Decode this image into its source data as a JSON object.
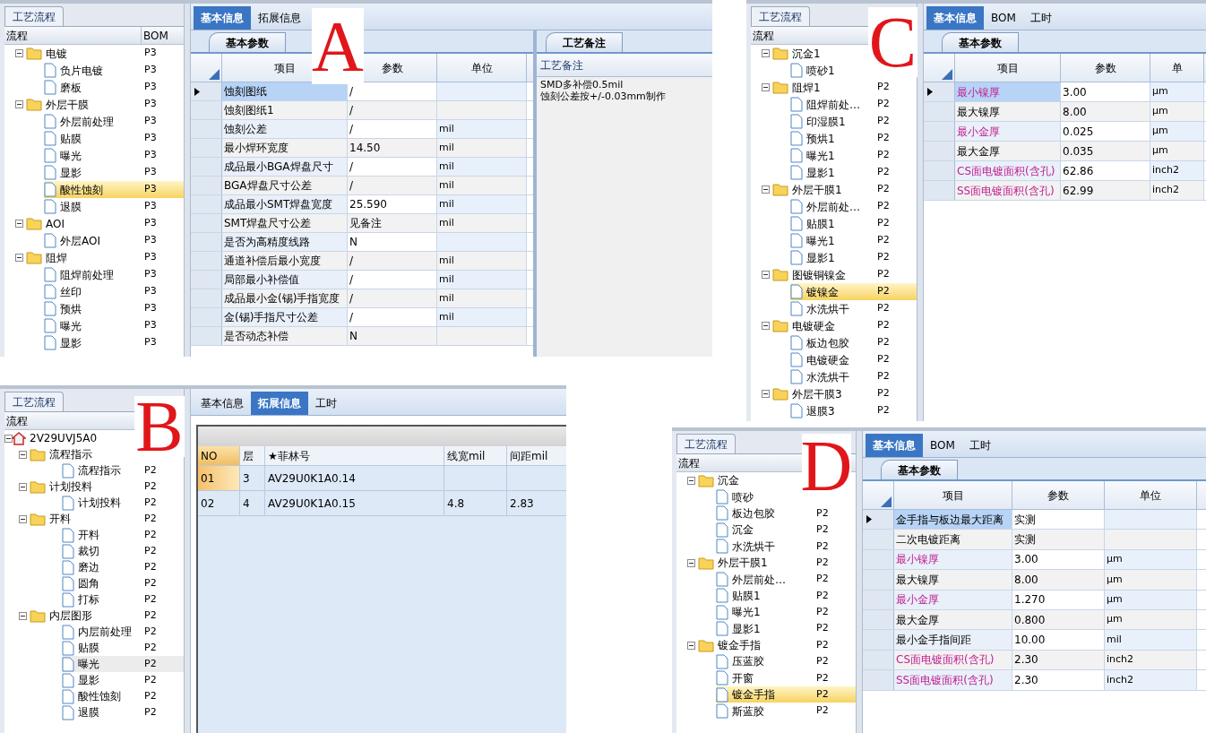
{
  "panels": [
    {
      "letter": "A",
      "tree_focused": true,
      "tree": {
        "tab": "工艺流程",
        "columns": [
          "流程",
          "BOM"
        ],
        "nodes": [
          {
            "kind": "folder",
            "label": "电镀",
            "code": "P3",
            "expanded": true,
            "selected": false,
            "children": [
              {
                "kind": "file",
                "label": "负片电镀",
                "code": "P3",
                "selected": false
              },
              {
                "kind": "file",
                "label": "磨板",
                "code": "P3",
                "selected": false
              }
            ]
          },
          {
            "kind": "folder",
            "label": "外层干膜",
            "code": "P3",
            "expanded": true,
            "selected": false,
            "children": [
              {
                "kind": "file",
                "label": "外层前处理",
                "code": "P3",
                "selected": false
              },
              {
                "kind": "file",
                "label": "贴膜",
                "code": "P3",
                "selected": false
              },
              {
                "kind": "file",
                "label": "曝光",
                "code": "P3",
                "selected": false
              },
              {
                "kind": "file",
                "label": "显影",
                "code": "P3",
                "selected": false
              },
              {
                "kind": "file",
                "label": "酸性蚀刻",
                "code": "P3",
                "selected": true
              },
              {
                "kind": "file",
                "label": "退膜",
                "code": "P3",
                "selected": false
              }
            ]
          },
          {
            "kind": "folder",
            "label": "AOI",
            "code": "P3",
            "expanded": true,
            "selected": false,
            "children": [
              {
                "kind": "file",
                "label": "外层AOI",
                "code": "P3",
                "selected": false
              }
            ]
          },
          {
            "kind": "folder",
            "label": "阻焊",
            "code": "P3",
            "expanded": true,
            "selected": false,
            "children": [
              {
                "kind": "file",
                "label": "阻焊前处理",
                "code": "P3",
                "selected": false
              },
              {
                "kind": "file",
                "label": "丝印",
                "code": "P3",
                "selected": false
              },
              {
                "kind": "file",
                "label": "预烘",
                "code": "P3",
                "selected": false
              },
              {
                "kind": "file",
                "label": "曝光",
                "code": "P3",
                "selected": false
              },
              {
                "kind": "file",
                "label": "显影",
                "code": "P3",
                "selected": false
              }
            ]
          }
        ]
      },
      "tabs": [
        {
          "label": "基本信息",
          "selected": true
        },
        {
          "label": "拓展信息",
          "selected": false
        }
      ],
      "content": {
        "kind": "grid",
        "subtab": "基本参数",
        "columns": [
          "项目",
          "参数",
          "单位"
        ],
        "rows": [
          {
            "item": "蚀刻图纸",
            "param": "/",
            "selected": true
          },
          {
            "item": "蚀刻图纸1",
            "param": "/",
            "selected": false
          },
          {
            "item": "蚀刻公差",
            "param": "/",
            "unit": "mil",
            "selected": false
          },
          {
            "item": "最小焊环宽度",
            "param": "14.50",
            "unit": "mil",
            "selected": false
          },
          {
            "item": "成品最小BGA焊盘尺寸",
            "param": "/",
            "unit": "mil",
            "selected": false
          },
          {
            "item": "BGA焊盘尺寸公差",
            "param": "/",
            "unit": "mil",
            "selected": false
          },
          {
            "item": "成品最小SMT焊盘宽度",
            "param": "25.590",
            "unit": "mil",
            "selected": false
          },
          {
            "item": "SMT焊盘尺寸公差",
            "param": "见备注",
            "unit": "mil",
            "selected": false
          },
          {
            "item": "是否为高精度线路",
            "param": "N",
            "selected": false
          },
          {
            "item": "通道补偿后最小宽度",
            "param": "/",
            "unit": "mil",
            "selected": false
          },
          {
            "item": "局部最小补偿值",
            "param": "/",
            "unit": "mil",
            "selected": false
          },
          {
            "item": "成品最小金(锡)手指宽度",
            "param": "/",
            "unit": "mil",
            "selected": false
          },
          {
            "item": "金(锡)手指尺寸公差",
            "param": "/",
            "unit": "mil",
            "selected": false
          },
          {
            "item": "是否动态补偿",
            "param": "N",
            "selected": false
          }
        ],
        "notes": {
          "tab": "工艺备注",
          "header": "工艺备注",
          "lines": [
            "SMD多补偿0.5mil",
            "蚀刻公差按+/-0.03mm制作"
          ]
        }
      }
    },
    {
      "letter": "C",
      "tree_focused": true,
      "tree": {
        "tab": "工艺流程",
        "columns": [
          "流程"
        ],
        "nodes": [
          {
            "kind": "folder",
            "label": "沉金1",
            "expanded": true,
            "selected": false,
            "children": [
              {
                "kind": "file",
                "label": "喷砂1",
                "selected": false
              }
            ]
          },
          {
            "kind": "folder",
            "label": "阻焊1",
            "code": "P2",
            "expanded": true,
            "selected": false,
            "children": [
              {
                "kind": "file",
                "label": "阻焊前处…",
                "code": "P2",
                "selected": false
              },
              {
                "kind": "file",
                "label": "印湿膜1",
                "code": "P2",
                "selected": false
              },
              {
                "kind": "file",
                "label": "预烘1",
                "code": "P2",
                "selected": false
              },
              {
                "kind": "file",
                "label": "曝光1",
                "code": "P2",
                "selected": false
              },
              {
                "kind": "file",
                "label": "显影1",
                "code": "P2",
                "selected": false
              }
            ]
          },
          {
            "kind": "folder",
            "label": "外层干膜1",
            "code": "P2",
            "expanded": true,
            "selected": false,
            "children": [
              {
                "kind": "file",
                "label": "外层前处…",
                "code": "P2",
                "selected": false
              },
              {
                "kind": "file",
                "label": "贴膜1",
                "code": "P2",
                "selected": false
              },
              {
                "kind": "file",
                "label": "曝光1",
                "code": "P2",
                "selected": false
              },
              {
                "kind": "file",
                "label": "显影1",
                "code": "P2",
                "selected": false
              }
            ]
          },
          {
            "kind": "folder",
            "label": "图镀铜镍金",
            "code": "P2",
            "expanded": true,
            "selected": false,
            "children": [
              {
                "kind": "file",
                "label": "镀镍金",
                "code": "P2",
                "selected": true
              },
              {
                "kind": "file",
                "label": "水洗烘干",
                "code": "P2",
                "selected": false
              }
            ]
          },
          {
            "kind": "folder",
            "label": "电镀硬金",
            "code": "P2",
            "expanded": true,
            "selected": false,
            "children": [
              {
                "kind": "file",
                "label": "板边包胶",
                "code": "P2",
                "selected": false
              },
              {
                "kind": "file",
                "label": "电镀硬金",
                "code": "P2",
                "selected": false
              },
              {
                "kind": "file",
                "label": "水洗烘干",
                "code": "P2",
                "selected": false
              }
            ]
          },
          {
            "kind": "folder",
            "label": "外层干膜3",
            "code": "P2",
            "expanded": true,
            "selected": false,
            "children": [
              {
                "kind": "file",
                "label": "退膜3",
                "code": "P2",
                "selected": false
              }
            ]
          }
        ]
      },
      "tabs": [
        {
          "label": "基本信息",
          "selected": true
        },
        {
          "label": "BOM",
          "selected": false
        },
        {
          "label": "工时",
          "selected": false
        }
      ],
      "content": {
        "kind": "grid",
        "subtab": "基本参数",
        "columns": [
          "项目",
          "参数",
          "单"
        ],
        "rows": [
          {
            "item": "最小镍厚",
            "param": "3.00",
            "unit": "μm",
            "highlighted": true,
            "selected": true
          },
          {
            "item": "最大镍厚",
            "param": "8.00",
            "unit": "μm",
            "highlighted": false,
            "selected": false
          },
          {
            "item": "最小金厚",
            "param": "0.025",
            "unit": "μm",
            "highlighted": true,
            "selected": false
          },
          {
            "item": "最大金厚",
            "param": "0.035",
            "unit": "μm",
            "highlighted": false,
            "selected": false
          },
          {
            "item": "CS面电镀面积(含孔)",
            "param": "62.86",
            "unit": "inch2",
            "highlighted": true,
            "selected": false
          },
          {
            "item": "SS面电镀面积(含孔)",
            "param": "62.99",
            "unit": "inch2",
            "highlighted": true,
            "selected": false
          }
        ]
      }
    },
    {
      "letter": "B",
      "tree_focused": false,
      "tree": {
        "tab": "工艺流程",
        "columns": [
          "流程"
        ],
        "nodes": [
          {
            "kind": "root",
            "label": "2V29UVJ5A0",
            "expanded": true,
            "selected": false,
            "children": [
              {
                "kind": "folder",
                "label": "流程指示",
                "expanded": true,
                "selected": false,
                "children": [
                  {
                    "kind": "file",
                    "label": "流程指示",
                    "code": "P2",
                    "selected": false
                  }
                ]
              },
              {
                "kind": "folder",
                "label": "计划投料",
                "code": "P2",
                "expanded": true,
                "selected": false,
                "children": [
                  {
                    "kind": "file",
                    "label": "计划投料",
                    "code": "P2",
                    "selected": false
                  }
                ]
              },
              {
                "kind": "folder",
                "label": "开料",
                "code": "P2",
                "expanded": true,
                "selected": false,
                "children": [
                  {
                    "kind": "file",
                    "label": "开料",
                    "code": "P2",
                    "selected": false
                  },
                  {
                    "kind": "file",
                    "label": "裁切",
                    "code": "P2",
                    "selected": false
                  },
                  {
                    "kind": "file",
                    "label": "磨边",
                    "code": "P2",
                    "selected": false
                  },
                  {
                    "kind": "file",
                    "label": "圆角",
                    "code": "P2",
                    "selected": false
                  },
                  {
                    "kind": "file",
                    "label": "打标",
                    "code": "P2",
                    "selected": false
                  }
                ]
              },
              {
                "kind": "folder",
                "label": "内层图形",
                "code": "P2",
                "expanded": true,
                "selected": false,
                "children": [
                  {
                    "kind": "file",
                    "label": "内层前处理",
                    "code": "P2",
                    "selected": false
                  },
                  {
                    "kind": "file",
                    "label": "贴膜",
                    "code": "P2",
                    "selected": false
                  },
                  {
                    "kind": "file",
                    "label": "曝光",
                    "code": "P2",
                    "selected": true
                  },
                  {
                    "kind": "file",
                    "label": "显影",
                    "code": "P2",
                    "selected": false
                  },
                  {
                    "kind": "file",
                    "label": "酸性蚀刻",
                    "code": "P2",
                    "selected": false
                  },
                  {
                    "kind": "file",
                    "label": "退膜",
                    "code": "P2",
                    "selected": false
                  }
                ]
              }
            ]
          }
        ]
      },
      "tabs": [
        {
          "label": "基本信息",
          "selected": false
        },
        {
          "label": "拓展信息",
          "selected": true
        },
        {
          "label": "工时",
          "selected": false
        }
      ],
      "content": {
        "kind": "table",
        "columns": [
          "NO",
          "层",
          "★菲林号",
          "线宽mil",
          "间距mil"
        ],
        "rows": [
          {
            "cells": [
              "01",
              "3",
              "AV29U0K1A0.14",
              null,
              null
            ],
            "selected": true
          },
          {
            "cells": [
              "02",
              "4",
              "AV29U0K1A0.15",
              "4.8",
              "2.83"
            ],
            "selected": false
          }
        ]
      }
    },
    {
      "letter": "D",
      "tree_focused": true,
      "tree": {
        "tab": "工艺流程",
        "columns": [
          "流程"
        ],
        "nodes": [
          {
            "kind": "folder",
            "label": "沉金",
            "expanded": true,
            "selected": false,
            "children": [
              {
                "kind": "file",
                "label": "喷砂",
                "selected": false
              },
              {
                "kind": "file",
                "label": "板边包胶",
                "code": "P2",
                "selected": false
              },
              {
                "kind": "file",
                "label": "沉金",
                "code": "P2",
                "selected": false
              },
              {
                "kind": "file",
                "label": "水洗烘干",
                "code": "P2",
                "selected": false
              }
            ]
          },
          {
            "kind": "folder",
            "label": "外层干膜1",
            "code": "P2",
            "expanded": true,
            "selected": false,
            "children": [
              {
                "kind": "file",
                "label": "外层前处…",
                "code": "P2",
                "selected": false
              },
              {
                "kind": "file",
                "label": "贴膜1",
                "code": "P2",
                "selected": false
              },
              {
                "kind": "file",
                "label": "曝光1",
                "code": "P2",
                "selected": false
              },
              {
                "kind": "file",
                "label": "显影1",
                "code": "P2",
                "selected": false
              }
            ]
          },
          {
            "kind": "folder",
            "label": "镀金手指",
            "code": "P2",
            "expanded": true,
            "selected": false,
            "children": [
              {
                "kind": "file",
                "label": "压蓝胶",
                "code": "P2",
                "selected": false
              },
              {
                "kind": "file",
                "label": "开窗",
                "code": "P2",
                "selected": false
              },
              {
                "kind": "file",
                "label": "镀金手指",
                "code": "P2",
                "selected": true
              },
              {
                "kind": "file",
                "label": "斯蓝胶",
                "code": "P2",
                "selected": false
              }
            ]
          }
        ]
      },
      "tabs": [
        {
          "label": "基本信息",
          "selected": true
        },
        {
          "label": "BOM",
          "selected": false
        },
        {
          "label": "工时",
          "selected": false
        }
      ],
      "content": {
        "kind": "grid",
        "subtab": "基本参数",
        "columns": [
          "项目",
          "参数",
          "单位"
        ],
        "rows": [
          {
            "item": "金手指与板边最大距离",
            "param": "实测",
            "highlighted": false,
            "selected": true
          },
          {
            "item": "二次电镀距离",
            "param": "实测",
            "highlighted": false,
            "selected": false
          },
          {
            "item": "最小镍厚",
            "param": "3.00",
            "unit": "μm",
            "highlighted": true,
            "selected": false
          },
          {
            "item": "最大镍厚",
            "param": "8.00",
            "unit": "μm",
            "highlighted": false,
            "selected": false
          },
          {
            "item": "最小金厚",
            "param": "1.270",
            "unit": "μm",
            "highlighted": true,
            "selected": false
          },
          {
            "item": "最大金厚",
            "param": "0.800",
            "unit": "μm",
            "highlighted": false,
            "selected": false
          },
          {
            "item": "最小金手指间距",
            "param": "10.00",
            "unit": "mil",
            "highlighted": false,
            "selected": false
          },
          {
            "item": "CS面电镀面积(含孔)",
            "param": "2.30",
            "unit": "inch2",
            "highlighted": true,
            "selected": false
          },
          {
            "item": "SS面电镀面积(含孔)",
            "param": "2.30",
            "unit": "inch2",
            "highlighted": true,
            "selected": false
          }
        ]
      }
    }
  ]
}
